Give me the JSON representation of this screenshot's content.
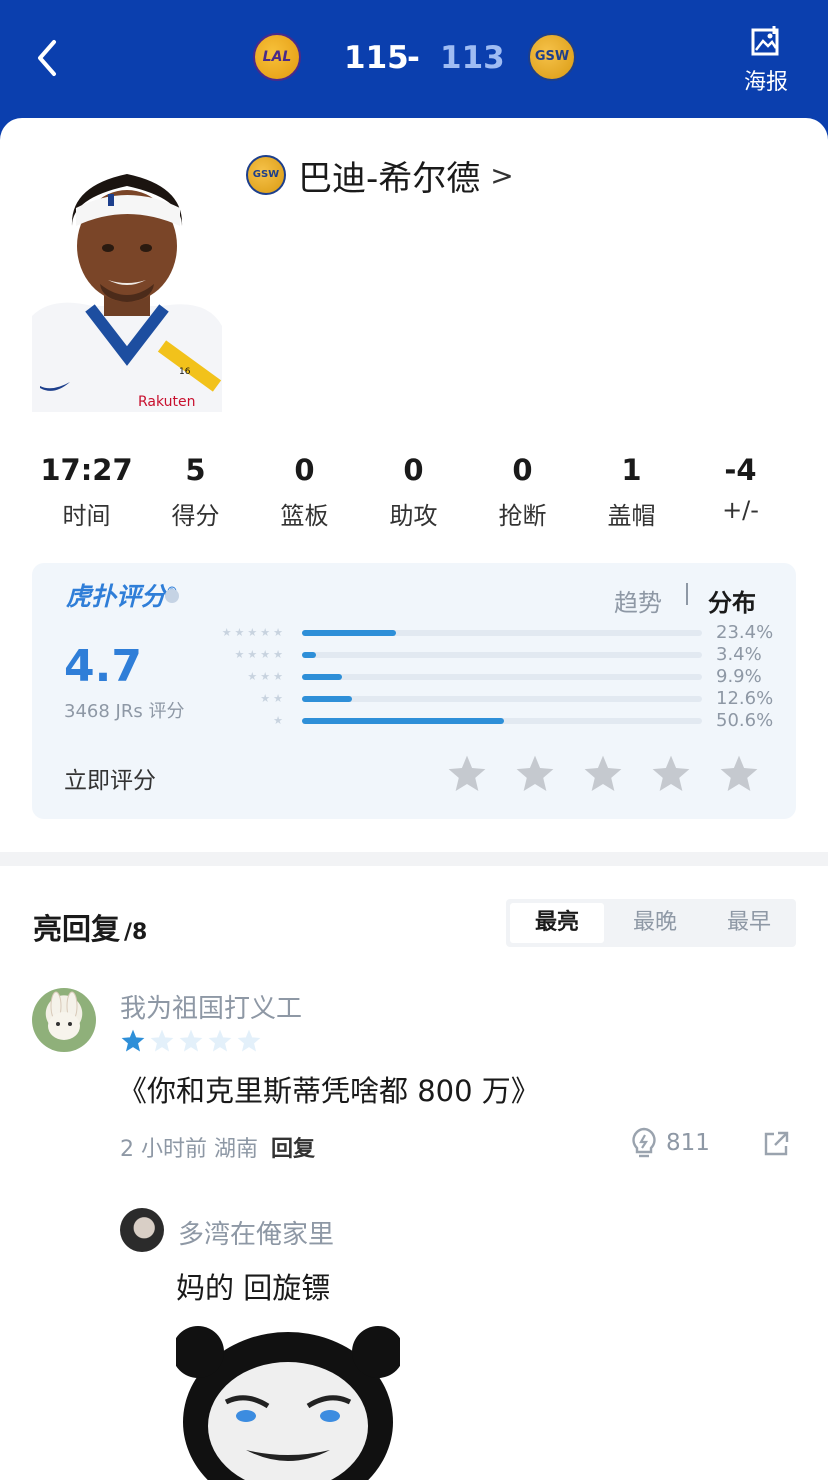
{
  "header": {
    "home_team_logo_text": "LAL",
    "away_team_logo_text": "GSW",
    "home_score": "115",
    "score_separator": "-",
    "away_score": "113",
    "poster_label": "海报"
  },
  "player": {
    "team_badge_text": "GSW",
    "name": "巴迪-希尔德",
    "chevron": ">",
    "jersey_text": "Rakuten",
    "jersey_number": "16"
  },
  "stats": [
    {
      "value": "17:27",
      "label": "时间"
    },
    {
      "value": "5",
      "label": "得分"
    },
    {
      "value": "0",
      "label": "篮板"
    },
    {
      "value": "0",
      "label": "助攻"
    },
    {
      "value": "0",
      "label": "抢断"
    },
    {
      "value": "1",
      "label": "盖帽"
    },
    {
      "value": "-4",
      "label": "+/-"
    }
  ],
  "rating": {
    "brand": "虎扑评分",
    "brand_mark": "®",
    "tab_trend": "趋势",
    "tab_distribution": "分布",
    "score": "4.7",
    "count_text": "3468 JRs 评分",
    "rate_now": "立即评分",
    "distribution": [
      {
        "stars": "★★★★★",
        "percent_text": "23.4%",
        "fraction": 0.234
      },
      {
        "stars": "★★★★",
        "percent_text": "3.4%",
        "fraction": 0.034
      },
      {
        "stars": "★★★",
        "percent_text": "9.9%",
        "fraction": 0.099
      },
      {
        "stars": "★★",
        "percent_text": "12.6%",
        "fraction": 0.126
      },
      {
        "stars": "★",
        "percent_text": "50.6%",
        "fraction": 0.506
      }
    ],
    "colors": {
      "accent": "#2f7ed8",
      "bar": "#2e8fd8",
      "star_empty": "#c5c9cf"
    }
  },
  "comments": {
    "title": "亮回复",
    "count": "/8",
    "sort_tabs": [
      "最亮",
      "最晚",
      "最早"
    ],
    "active_tab": "最亮",
    "items": [
      {
        "user": "我为祖国打义工",
        "user_rating": 1,
        "text": "《你和克里斯蒂凭啥都 800 万》",
        "time": "2 小时前",
        "location": "湖南",
        "reply_label": "回复",
        "lights": "811"
      }
    ],
    "reply": {
      "user": "多湾在俺家里",
      "text": "妈的 回旋镖"
    }
  },
  "icons": {
    "back": "chevron-left-icon",
    "poster": "image-export-icon",
    "light": "lightbulb-icon",
    "share": "share-icon",
    "info": "info-icon"
  }
}
